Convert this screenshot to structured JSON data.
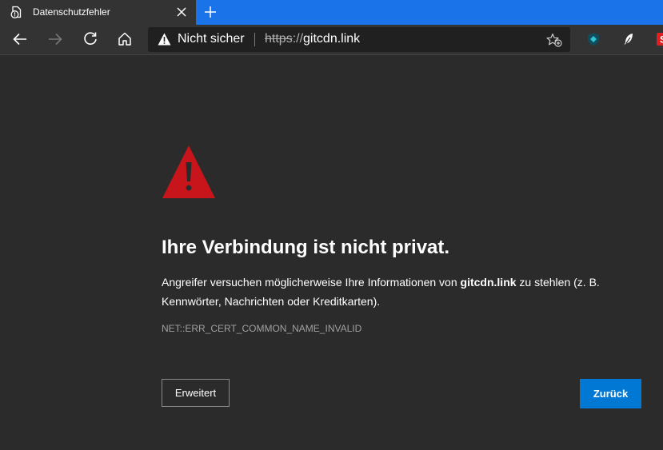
{
  "tab": {
    "title": "Datenschutzfehler",
    "favicon": "page-warning-icon",
    "close_icon": "close-icon",
    "new_tab_icon": "plus-icon"
  },
  "toolbar": {
    "back_icon": "arrow-left-icon",
    "forward_icon": "arrow-right-icon",
    "reload_icon": "reload-icon",
    "home_icon": "home-icon",
    "favorites_icon": "star-add-icon",
    "extensions": [
      "shield-extension-icon",
      "feather-extension-icon",
      "red-extension-icon"
    ]
  },
  "omnibox": {
    "security_label": "Nicht sicher",
    "url_scheme": "https",
    "url_sep": "://",
    "url_host": "gitcdn.link"
  },
  "page": {
    "heading": "Ihre Verbindung ist nicht privat.",
    "message_before": "Angreifer versuchen möglicherweise Ihre Informationen von ",
    "message_host": "gitcdn.link",
    "message_after": " zu stehlen (z. B. Kennwörter, Nachrichten oder Kreditkarten).",
    "error_code": "NET::ERR_CERT_COMMON_NAME_INVALID",
    "advanced_button": "Erweitert",
    "back_button": "Zurück"
  },
  "colors": {
    "tabstrip": "#1a73e8",
    "chrome": "#333333",
    "page_bg": "#2b2b2b",
    "warning_red": "#c8141b",
    "primary_button": "#0078d4"
  }
}
